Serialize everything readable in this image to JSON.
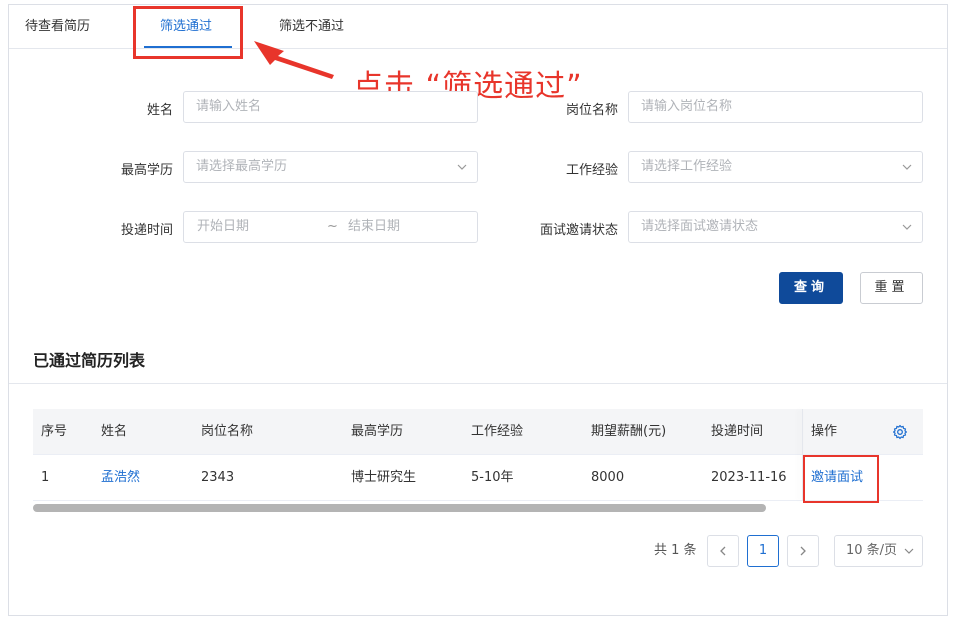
{
  "tabs": [
    {
      "label": "待查看简历"
    },
    {
      "label": "筛选通过"
    },
    {
      "label": "筛选不通过"
    }
  ],
  "annotation": {
    "text": "点击 “筛选通过”"
  },
  "form": {
    "name_label": "姓名",
    "name_placeholder": "请输入姓名",
    "position_label": "岗位名称",
    "position_placeholder": "请输入岗位名称",
    "education_label": "最高学历",
    "education_placeholder": "请选择最高学历",
    "experience_label": "工作经验",
    "experience_placeholder": "请选择工作经验",
    "date_label": "投递时间",
    "date_start_placeholder": "开始日期",
    "date_separator": "~",
    "date_end_placeholder": "结束日期",
    "invite_status_label": "面试邀请状态",
    "invite_status_placeholder": "请选择面试邀请状态",
    "query_button": "查询",
    "reset_button": "重置"
  },
  "section_title": "已通过简历列表",
  "table": {
    "headers": [
      "序号",
      "姓名",
      "岗位名称",
      "最高学历",
      "工作经验",
      "期望薪酬(元)",
      "投递时间",
      "操作"
    ],
    "rows": [
      {
        "index": "1",
        "name": "孟浩然",
        "position": "2343",
        "education": "博士研究生",
        "experience": "5-10年",
        "salary": "8000",
        "date": "2023-11-16",
        "action": "邀请面试"
      }
    ]
  },
  "pagination": {
    "total": "共 1 条",
    "prev_icon": "chevron-left-icon",
    "current_page": "1",
    "next_icon": "chevron-right-icon",
    "page_size": "10 条/页"
  },
  "colors": {
    "accent": "#1f6fd1",
    "primary_button": "#0f4a9a",
    "annotation_red": "#e8352b"
  }
}
